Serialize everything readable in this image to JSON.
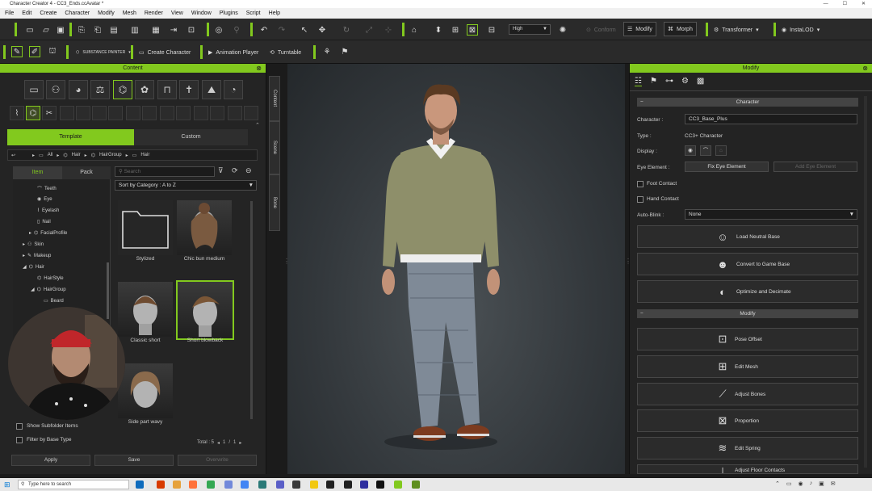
{
  "window": {
    "title": "Character Creator 4 - CC3_Ends.ccAvatar *"
  },
  "menu": [
    "File",
    "Edit",
    "Create",
    "Character",
    "Modify",
    "Mesh",
    "Render",
    "View",
    "Window",
    "Plugins",
    "Script",
    "Help"
  ],
  "toolbar": {
    "quality": "High",
    "conform": "Conform",
    "modify": "Modify",
    "morph": "Morph",
    "transformer": "Transformer",
    "instalod": "InstaLOD",
    "substance": "SUBSTANCE PAINTER",
    "create_character": "Create Character",
    "animation_player": "Animation Player",
    "turntable": "Turntable"
  },
  "content_panel": {
    "title": "Content",
    "tabs": {
      "template": "Template",
      "custom": "Custom"
    },
    "breadcrumb": [
      "All",
      "Hair",
      "HairGroup",
      "Hair"
    ],
    "subtabs": {
      "item": "Item",
      "pack": "Pack"
    },
    "search_placeholder": "Search",
    "sort": "Sort by Category : A to Z",
    "tree": [
      "Teeth",
      "Eye",
      "Eyelash",
      "Nail",
      "FacialProfile",
      "Skin",
      "Makeup",
      "Hair",
      "HairStyle",
      "HairGroup",
      "Beard"
    ],
    "items": [
      "Stylized",
      "Chic bun medium",
      "Classic short",
      "Short blowback",
      "Side part wavy"
    ],
    "total": "Total : 5",
    "page": "1",
    "page_sep": "/",
    "page_total": "1",
    "show_subfolder": "Show Subfolder Items",
    "filter_base": "Filter by Base Type",
    "apply": "Apply",
    "save": "Save",
    "overwrite": "Overwrite"
  },
  "side_tabs": [
    "Content",
    "Scene",
    "Bone"
  ],
  "modify_panel": {
    "title": "Modify",
    "section_character": "Character",
    "character_label": "Character :",
    "character_value": "CC3_Base_Plus",
    "type_label": "Type :",
    "type_value": "CC3+ Character",
    "display_label": "Display :",
    "eye_element_label": "Eye Element :",
    "fix_eye": "Fix Eye Element",
    "add_eye": "Add Eye Element",
    "foot_contact": "Foot Contact",
    "hand_contact": "Hand Contact",
    "autoblink_label": "Auto-Blink :",
    "autoblink_value": "None",
    "load_neutral": "Load Neutral Base",
    "convert_game": "Convert to Game Base",
    "optimize": "Optimize and Decimate",
    "section_modify": "Modify",
    "pose_offset": "Pose Offset",
    "edit_mesh": "Edit Mesh",
    "adjust_bones": "Adjust Bones",
    "proportion": "Proportion",
    "edit_spring": "Edit Spring",
    "adjust_floor": "Adjust Floor Contacts"
  },
  "taskbar": {
    "search": "Type here to search"
  },
  "colors": {
    "accent": "#82c91e",
    "panel": "#242424",
    "viewport": "#34393d"
  }
}
